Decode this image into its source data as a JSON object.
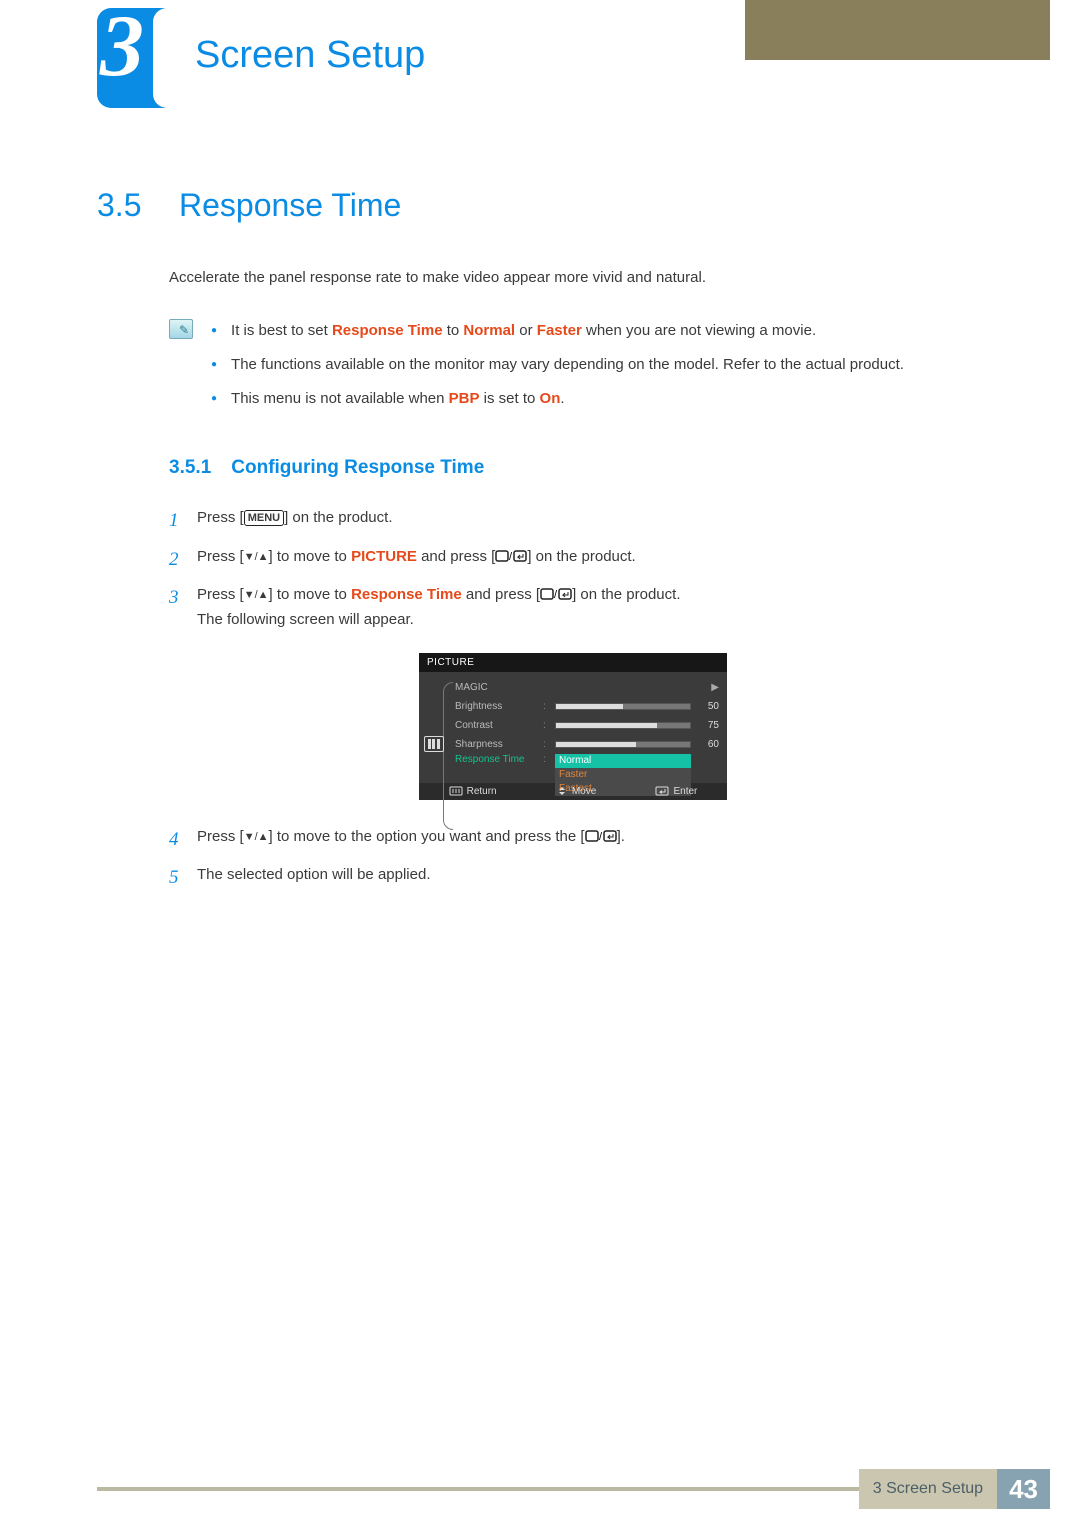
{
  "chapter": {
    "number": "3",
    "title": "Screen Setup"
  },
  "section": {
    "number": "3.5",
    "title": "Response Time"
  },
  "intro": "Accelerate the panel response rate to make video appear more vivid and natural.",
  "notes": {
    "n1_a": "It is best to set ",
    "n1_b": "Response Time",
    "n1_c": " to ",
    "n1_d": "Normal",
    "n1_e": " or ",
    "n1_f": "Faster",
    "n1_g": " when you are not viewing a movie.",
    "n2": "The functions available on the monitor may vary depending on the model. Refer to the actual product.",
    "n3_a": "This menu is not available when ",
    "n3_b": "PBP",
    "n3_c": " is set to ",
    "n3_d": "On",
    "n3_e": "."
  },
  "subsection": {
    "number": "3.5.1",
    "title": "Configuring Response Time"
  },
  "steps": {
    "s1_a": "Press [",
    "s1_menu": "MENU",
    "s1_b": "] on the product.",
    "s2_a": "Press [",
    "s2_b": "] to move to ",
    "s2_c": "PICTURE",
    "s2_d": " and press [",
    "s2_e": "] on the product.",
    "s3_a": "Press [",
    "s3_b": "] to move to ",
    "s3_c": "Response Time",
    "s3_d": " and press [",
    "s3_e": "] on the product.",
    "s3_line2": "The following screen will appear.",
    "s4_a": "Press [",
    "s4_b": "] to move to the option you want and press the [",
    "s4_c": "].",
    "s5": "The selected option will be applied."
  },
  "osd": {
    "title": "PICTURE",
    "items": {
      "magic": "MAGIC",
      "brightness": "Brightness",
      "contrast": "Contrast",
      "sharpness": "Sharpness",
      "response": "Response Time"
    },
    "values": {
      "brightness": 50,
      "contrast": 75,
      "sharpness": 60
    },
    "options": {
      "normal": "Normal",
      "faster": "Faster",
      "fastest": "Fastest"
    },
    "footer": {
      "return": "Return",
      "move": "Move",
      "enter": "Enter"
    }
  },
  "footer": {
    "label": "3 Screen Setup",
    "page": "43"
  }
}
